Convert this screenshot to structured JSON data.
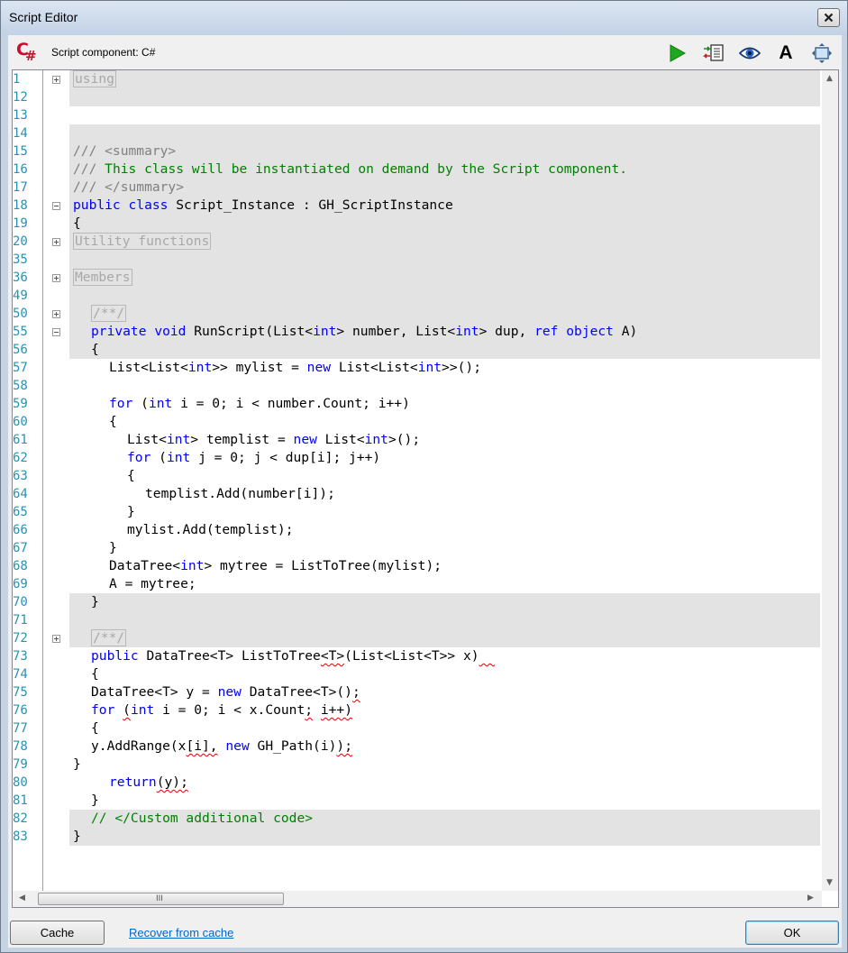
{
  "window": {
    "title": "Script Editor",
    "close_icon": "close-icon"
  },
  "toolbar": {
    "logo_c": "C",
    "logo_sharp": "#",
    "component_label": "Script component: C#",
    "icons": [
      "run-icon",
      "export-icon",
      "preview-icon",
      "font-icon",
      "window-fit-icon"
    ],
    "font_glyph": "A",
    "colors": {
      "run": "#1fa81f",
      "logo": "#c8102e"
    }
  },
  "editor": {
    "colors": {
      "keyword": "#0000ff",
      "comment": "#008000",
      "line_number": "#2b91af",
      "highlight": "#e3e3e3",
      "squiggle": "#e00000"
    },
    "lines": [
      {
        "n": "1",
        "fold": "plus",
        "hl": true,
        "indent": 0,
        "segs": [
          {
            "t": "using",
            "c": "collapsed"
          }
        ]
      },
      {
        "n": "12",
        "fold": "",
        "hl": true,
        "indent": 0,
        "segs": []
      },
      {
        "n": "13",
        "fold": "",
        "hl": false,
        "indent": 0,
        "segs": []
      },
      {
        "n": "14",
        "fold": "",
        "hl": true,
        "indent": 0,
        "segs": []
      },
      {
        "n": "15",
        "fold": "",
        "hl": true,
        "indent": 0,
        "segs": [
          {
            "t": "/// <summary>",
            "c": "gc"
          }
        ]
      },
      {
        "n": "16",
        "fold": "",
        "hl": true,
        "indent": 0,
        "segs": [
          {
            "t": "/// ",
            "c": "gc"
          },
          {
            "t": "This class will be instantiated on demand by the Script component.",
            "c": "cm"
          }
        ]
      },
      {
        "n": "17",
        "fold": "",
        "hl": true,
        "indent": 0,
        "segs": [
          {
            "t": "/// </summary>",
            "c": "gc"
          }
        ]
      },
      {
        "n": "18",
        "fold": "minus",
        "hl": true,
        "indent": 0,
        "segs": [
          {
            "t": "public",
            "c": "kw"
          },
          {
            "t": " "
          },
          {
            "t": "class",
            "c": "kw"
          },
          {
            "t": " Script_Instance : GH_ScriptInstance"
          }
        ]
      },
      {
        "n": "19",
        "fold": "",
        "hl": true,
        "indent": 0,
        "segs": [
          {
            "t": "{"
          }
        ]
      },
      {
        "n": "20",
        "fold": "plus",
        "hl": true,
        "indent": 0,
        "segs": [
          {
            "t": "Utility functions",
            "c": "collapsed"
          }
        ]
      },
      {
        "n": "35",
        "fold": "",
        "hl": true,
        "indent": 0,
        "segs": []
      },
      {
        "n": "36",
        "fold": "plus",
        "hl": true,
        "indent": 0,
        "segs": [
          {
            "t": "Members",
            "c": "collapsed"
          }
        ]
      },
      {
        "n": "49",
        "fold": "",
        "hl": true,
        "indent": 0,
        "segs": []
      },
      {
        "n": "50",
        "fold": "plus",
        "hl": true,
        "indent": 1,
        "segs": [
          {
            "t": "/**/",
            "c": "collapsed"
          }
        ]
      },
      {
        "n": "55",
        "fold": "minus",
        "hl": true,
        "indent": 1,
        "segs": [
          {
            "t": "private",
            "c": "kw"
          },
          {
            "t": " "
          },
          {
            "t": "void",
            "c": "kw"
          },
          {
            "t": " RunScript(List<"
          },
          {
            "t": "int",
            "c": "kw"
          },
          {
            "t": "> number, List<"
          },
          {
            "t": "int",
            "c": "kw"
          },
          {
            "t": "> dup, "
          },
          {
            "t": "ref",
            "c": "kw"
          },
          {
            "t": " "
          },
          {
            "t": "object",
            "c": "kw"
          },
          {
            "t": " A)"
          }
        ]
      },
      {
        "n": "56",
        "fold": "",
        "hl": true,
        "indent": 1,
        "segs": [
          {
            "t": "{"
          }
        ]
      },
      {
        "n": "57",
        "fold": "",
        "hl": false,
        "indent": 2,
        "segs": [
          {
            "t": "List<List<"
          },
          {
            "t": "int",
            "c": "kw"
          },
          {
            "t": ">> mylist = "
          },
          {
            "t": "new",
            "c": "kw"
          },
          {
            "t": " List<List<"
          },
          {
            "t": "int",
            "c": "kw"
          },
          {
            "t": ">>();"
          }
        ]
      },
      {
        "n": "58",
        "fold": "",
        "hl": false,
        "indent": 0,
        "segs": []
      },
      {
        "n": "59",
        "fold": "",
        "hl": false,
        "indent": 2,
        "segs": [
          {
            "t": "for",
            "c": "kw"
          },
          {
            "t": " ("
          },
          {
            "t": "int",
            "c": "kw"
          },
          {
            "t": " i = 0; i < number.Count; i++)"
          }
        ]
      },
      {
        "n": "60",
        "fold": "",
        "hl": false,
        "indent": 2,
        "segs": [
          {
            "t": "{"
          }
        ]
      },
      {
        "n": "61",
        "fold": "",
        "hl": false,
        "indent": 3,
        "segs": [
          {
            "t": "List<"
          },
          {
            "t": "int",
            "c": "kw"
          },
          {
            "t": "> templist = "
          },
          {
            "t": "new",
            "c": "kw"
          },
          {
            "t": " List<"
          },
          {
            "t": "int",
            "c": "kw"
          },
          {
            "t": ">();"
          }
        ]
      },
      {
        "n": "62",
        "fold": "",
        "hl": false,
        "indent": 3,
        "segs": [
          {
            "t": "for",
            "c": "kw"
          },
          {
            "t": " ("
          },
          {
            "t": "int",
            "c": "kw"
          },
          {
            "t": " j = 0; j < dup[i]; j++)"
          }
        ]
      },
      {
        "n": "63",
        "fold": "",
        "hl": false,
        "indent": 3,
        "segs": [
          {
            "t": "{"
          }
        ]
      },
      {
        "n": "64",
        "fold": "",
        "hl": false,
        "indent": 4,
        "segs": [
          {
            "t": "templist.Add(number[i]);"
          }
        ]
      },
      {
        "n": "65",
        "fold": "",
        "hl": false,
        "indent": 3,
        "segs": [
          {
            "t": "}"
          }
        ]
      },
      {
        "n": "66",
        "fold": "",
        "hl": false,
        "indent": 3,
        "segs": [
          {
            "t": "mylist.Add(templist);"
          }
        ]
      },
      {
        "n": "67",
        "fold": "",
        "hl": false,
        "indent": 2,
        "segs": [
          {
            "t": "}"
          }
        ]
      },
      {
        "n": "68",
        "fold": "",
        "hl": false,
        "indent": 2,
        "segs": [
          {
            "t": "DataTree<"
          },
          {
            "t": "int",
            "c": "kw"
          },
          {
            "t": "> mytree = ListToTree(mylist);"
          }
        ]
      },
      {
        "n": "69",
        "fold": "",
        "hl": false,
        "indent": 2,
        "segs": [
          {
            "t": "A = mytree;"
          }
        ]
      },
      {
        "n": "70",
        "fold": "",
        "hl": true,
        "indent": 1,
        "segs": [
          {
            "t": "}"
          }
        ]
      },
      {
        "n": "71",
        "fold": "",
        "hl": true,
        "indent": 0,
        "segs": []
      },
      {
        "n": "72",
        "fold": "plus",
        "hl": true,
        "indent": 1,
        "segs": [
          {
            "t": "/**/",
            "c": "collapsed"
          }
        ]
      },
      {
        "n": "73",
        "fold": "",
        "hl": false,
        "indent": 1,
        "segs": [
          {
            "t": "public",
            "c": "kw"
          },
          {
            "t": " DataTree<T> ListToTree"
          },
          {
            "t": "<T>",
            "c": "sq"
          },
          {
            "t": "(List<List<T>> x)"
          },
          {
            "t": "  ",
            "c": "sq"
          }
        ]
      },
      {
        "n": "74",
        "fold": "",
        "hl": false,
        "indent": 1,
        "segs": [
          {
            "t": "{"
          }
        ]
      },
      {
        "n": "75",
        "fold": "",
        "hl": false,
        "indent": 1,
        "segs": [
          {
            "t": "DataTree<T> y = "
          },
          {
            "t": "new",
            "c": "kw"
          },
          {
            "t": " DataTree<T>()"
          },
          {
            "t": ";",
            "c": "sq"
          }
        ]
      },
      {
        "n": "76",
        "fold": "",
        "hl": false,
        "indent": 1,
        "segs": [
          {
            "t": "for",
            "c": "kw"
          },
          {
            "t": " "
          },
          {
            "t": "(",
            "c": "sq"
          },
          {
            "t": "int",
            "c": "kw"
          },
          {
            "t": " i = 0; i < x.Count"
          },
          {
            "t": ";",
            "c": "sq"
          },
          {
            "t": " "
          },
          {
            "t": "i++)",
            "c": "sq"
          }
        ]
      },
      {
        "n": "77",
        "fold": "",
        "hl": false,
        "indent": 1,
        "segs": [
          {
            "t": "{"
          }
        ]
      },
      {
        "n": "78",
        "fold": "",
        "hl": false,
        "indent": 1,
        "segs": [
          {
            "t": "y.AddRange(x"
          },
          {
            "t": "[i],",
            "c": "sq"
          },
          {
            "t": " "
          },
          {
            "t": "new",
            "c": "kw"
          },
          {
            "t": " GH_Path(i)"
          },
          {
            "t": ");",
            "c": "sq"
          }
        ]
      },
      {
        "n": "79",
        "fold": "",
        "hl": false,
        "indent": 0,
        "segs": [
          {
            "t": "}"
          }
        ]
      },
      {
        "n": "80",
        "fold": "",
        "hl": false,
        "indent": 2,
        "segs": [
          {
            "t": "return",
            "c": "kw"
          },
          {
            "t": "(y);",
            "c": "sq"
          }
        ]
      },
      {
        "n": "81",
        "fold": "",
        "hl": false,
        "indent": 1,
        "segs": [
          {
            "t": "}"
          }
        ]
      },
      {
        "n": "82",
        "fold": "",
        "hl": true,
        "indent": 1,
        "segs": [
          {
            "t": "// </Custom additional code>",
            "c": "cm"
          }
        ]
      },
      {
        "n": "83",
        "fold": "",
        "hl": true,
        "indent": 0,
        "segs": [
          {
            "t": "}"
          }
        ]
      }
    ]
  },
  "scrollbar": {
    "grip": "III",
    "up_arrow": "▲",
    "down_arrow": "▼",
    "left_arrow": "◀",
    "right_arrow": "▶"
  },
  "footer": {
    "cache_label": "Cache",
    "recover_label": "Recover from cache",
    "ok_label": "OK"
  }
}
